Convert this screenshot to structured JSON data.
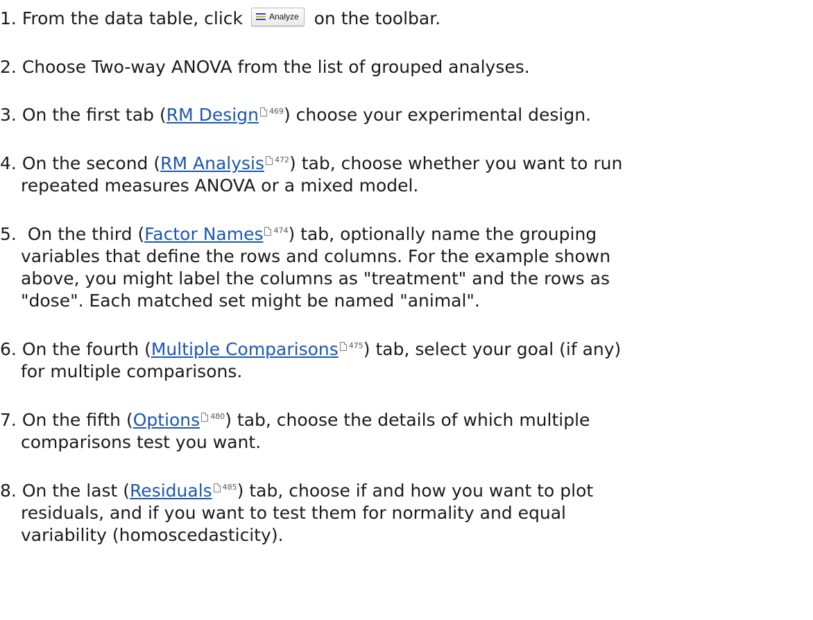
{
  "toolbar_button": {
    "label": "Analyze",
    "icon": "analyze-icon"
  },
  "steps": [
    {
      "number": "1.",
      "before": "From the data table, click",
      "after": "on the toolbar."
    },
    {
      "number": "2.",
      "text": "Choose Two-way ANOVA from the list of grouped analyses."
    },
    {
      "number": "3.",
      "before": "On the first tab (",
      "link": "RM Design",
      "page_ref": "469",
      "after": ") choose your experimental design."
    },
    {
      "number": "4.",
      "before": "On the second (",
      "link": "RM Analysis",
      "page_ref": "472",
      "after": ") tab, choose whether you want to run",
      "cont_lines": [
        "repeated measures ANOVA or a mixed model."
      ]
    },
    {
      "number": "5.",
      "before": " On the third (",
      "link": "Factor Names",
      "page_ref": "474",
      "after": ") tab, optionally name the grouping",
      "cont_lines": [
        "variables that define the rows and columns. For the example shown",
        "above, you might label the columns as \"treatment\" and the rows as",
        "\"dose\". Each matched set might be named \"animal\"."
      ]
    },
    {
      "number": "6.",
      "before": "On the fourth (",
      "link": "Multiple Comparisons",
      "page_ref": "475",
      "after": ") tab, select your goal (if any)",
      "cont_lines": [
        "for multiple comparisons."
      ]
    },
    {
      "number": "7.",
      "before": "On the fifth (",
      "link": "Options",
      "page_ref": "480",
      "after": ") tab, choose the details of which multiple",
      "cont_lines": [
        "comparisons test you want."
      ]
    },
    {
      "number": "8.",
      "before": "On the last (",
      "link": "Residuals",
      "page_ref": "485",
      "after": ") tab, choose if and how you want to plot",
      "cont_lines": [
        "residuals, and if you want to test them for normality and equal",
        "variability (homoscedasticity)."
      ]
    }
  ]
}
